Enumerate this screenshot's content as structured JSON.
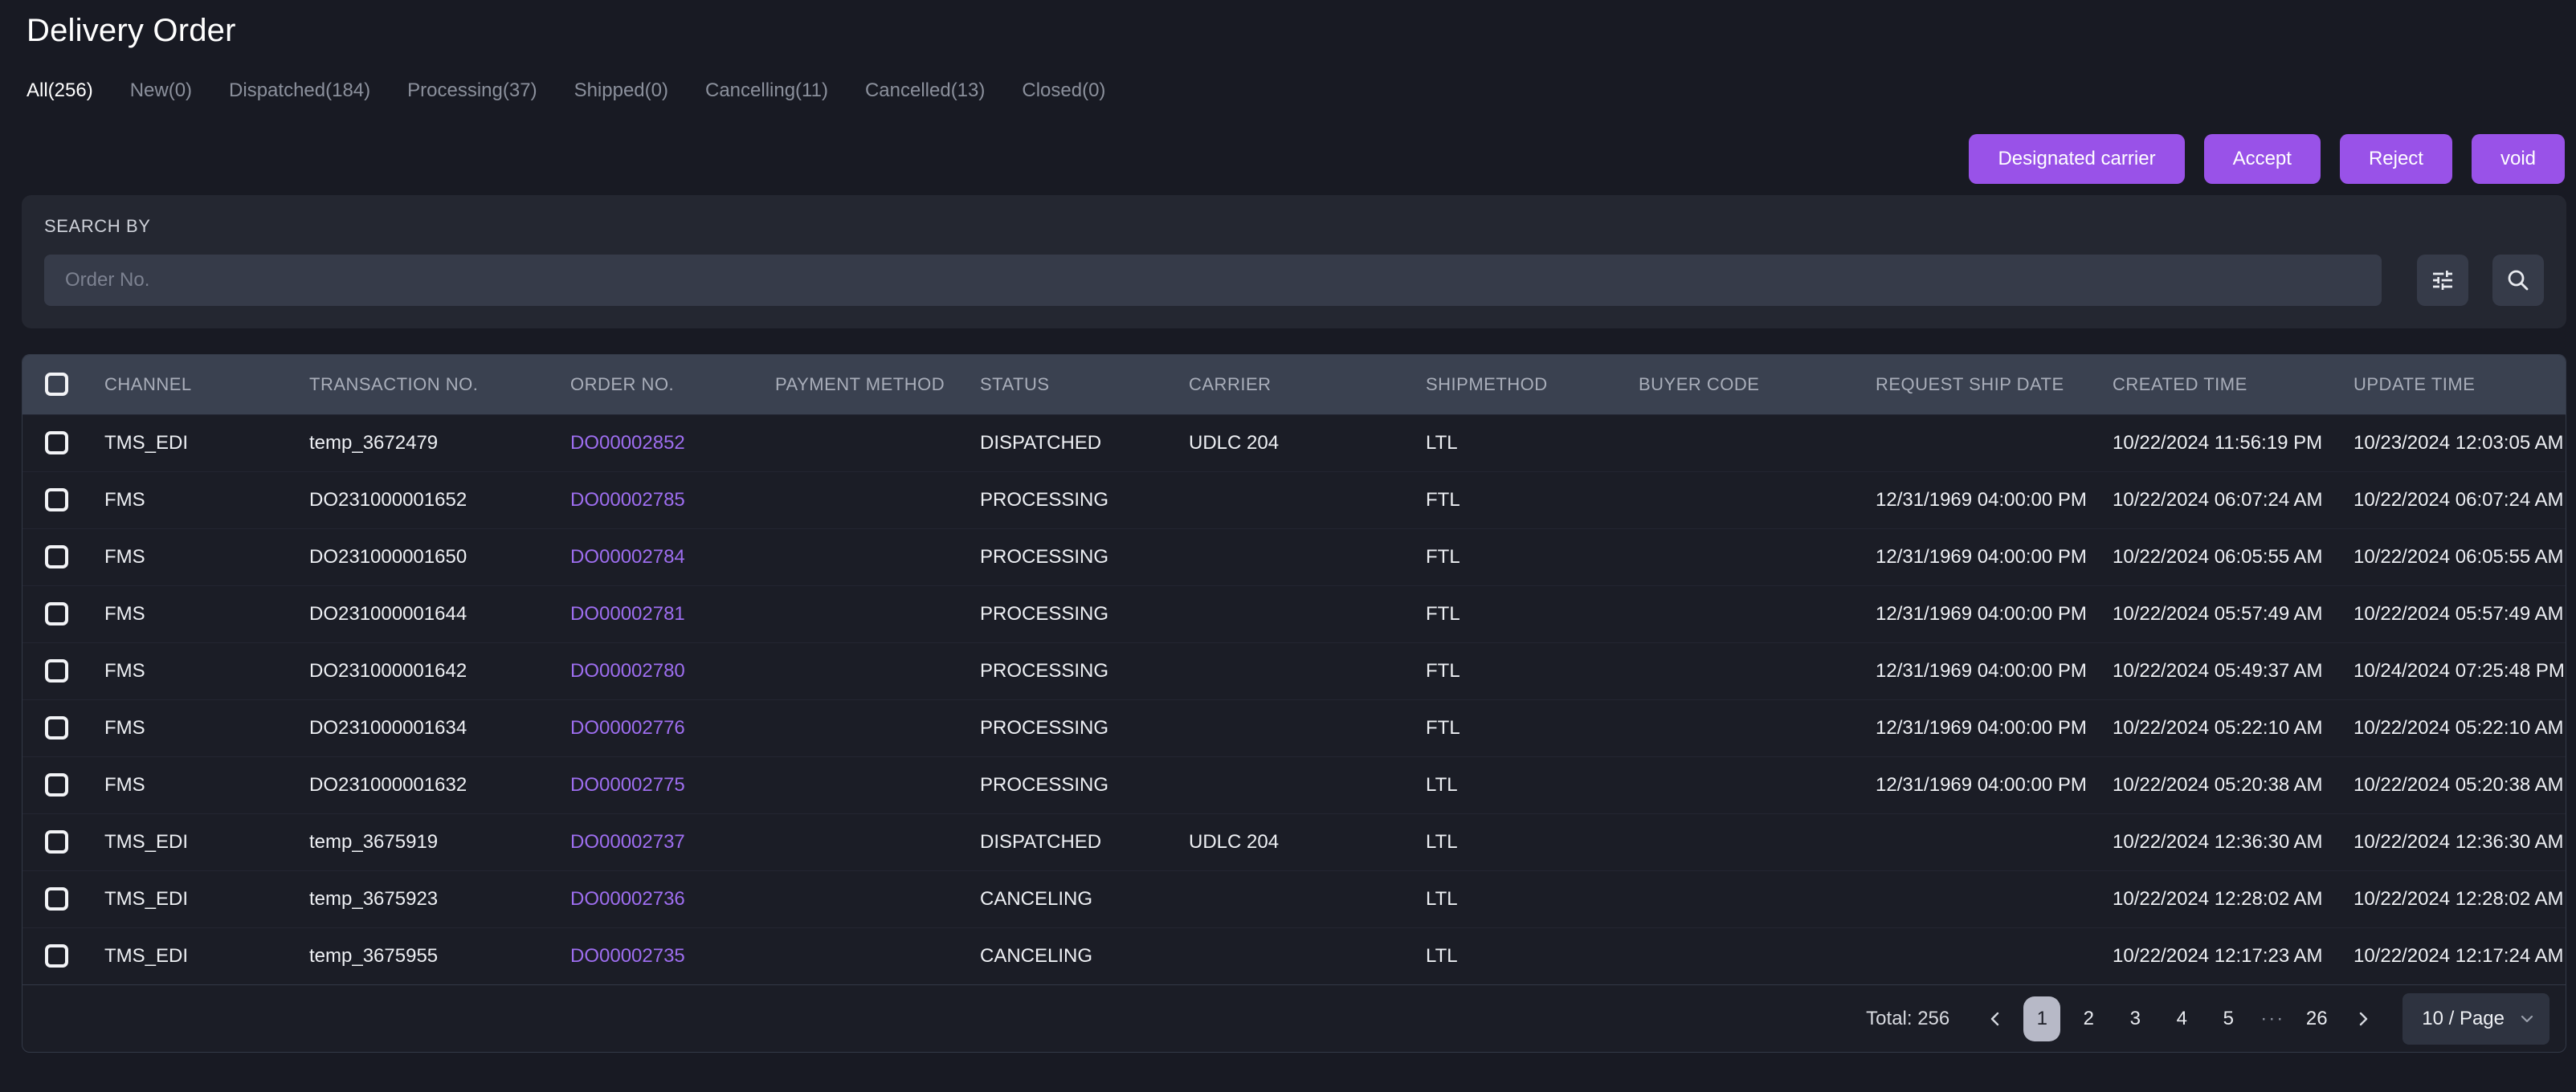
{
  "page": {
    "title": "Delivery Order"
  },
  "tabs": [
    {
      "key": "all",
      "label": "All(256)",
      "active": true
    },
    {
      "key": "new",
      "label": "New(0)",
      "active": false
    },
    {
      "key": "dispatched",
      "label": "Dispatched(184)",
      "active": false
    },
    {
      "key": "processing",
      "label": "Processing(37)",
      "active": false
    },
    {
      "key": "shipped",
      "label": "Shipped(0)",
      "active": false
    },
    {
      "key": "cancelling",
      "label": "Cancelling(11)",
      "active": false
    },
    {
      "key": "cancelled",
      "label": "Cancelled(13)",
      "active": false
    },
    {
      "key": "closed",
      "label": "Closed(0)",
      "active": false
    }
  ],
  "actions": {
    "designated_carrier": "Designated carrier",
    "accept": "Accept",
    "reject": "Reject",
    "void": "void"
  },
  "search": {
    "label": "SEARCH BY",
    "placeholder": "Order No."
  },
  "icons": {
    "filter": "tune-sliders-icon",
    "search": "magnifier-icon"
  },
  "table": {
    "columns": [
      "CHANNEL",
      "TRANSACTION NO.",
      "ORDER NO.",
      "PAYMENT METHOD",
      "STATUS",
      "CARRIER",
      "SHIPMETHOD",
      "BUYER CODE",
      "REQUEST SHIP DATE",
      "CREATED TIME",
      "UPDATE TIME"
    ],
    "rows": [
      {
        "channel": "TMS_EDI",
        "transaction_no": "temp_3672479",
        "order_no": "DO00002852",
        "payment_method": "",
        "status": "DISPATCHED",
        "carrier": "UDLC 204",
        "shipmethod": "LTL",
        "buyer_code": "",
        "request_ship_date": "",
        "created_time": "10/22/2024 11:56:19 PM",
        "update_time": "10/23/2024 12:03:05 AM"
      },
      {
        "channel": "FMS",
        "transaction_no": "DO231000001652",
        "order_no": "DO00002785",
        "payment_method": "",
        "status": "PROCESSING",
        "carrier": "",
        "shipmethod": "FTL",
        "buyer_code": "",
        "request_ship_date": "12/31/1969 04:00:00 PM",
        "created_time": "10/22/2024 06:07:24 AM",
        "update_time": "10/22/2024 06:07:24 AM"
      },
      {
        "channel": "FMS",
        "transaction_no": "DO231000001650",
        "order_no": "DO00002784",
        "payment_method": "",
        "status": "PROCESSING",
        "carrier": "",
        "shipmethod": "FTL",
        "buyer_code": "",
        "request_ship_date": "12/31/1969 04:00:00 PM",
        "created_time": "10/22/2024 06:05:55 AM",
        "update_time": "10/22/2024 06:05:55 AM"
      },
      {
        "channel": "FMS",
        "transaction_no": "DO231000001644",
        "order_no": "DO00002781",
        "payment_method": "",
        "status": "PROCESSING",
        "carrier": "",
        "shipmethod": "FTL",
        "buyer_code": "",
        "request_ship_date": "12/31/1969 04:00:00 PM",
        "created_time": "10/22/2024 05:57:49 AM",
        "update_time": "10/22/2024 05:57:49 AM"
      },
      {
        "channel": "FMS",
        "transaction_no": "DO231000001642",
        "order_no": "DO00002780",
        "payment_method": "",
        "status": "PROCESSING",
        "carrier": "",
        "shipmethod": "FTL",
        "buyer_code": "",
        "request_ship_date": "12/31/1969 04:00:00 PM",
        "created_time": "10/22/2024 05:49:37 AM",
        "update_time": "10/24/2024 07:25:48 PM"
      },
      {
        "channel": "FMS",
        "transaction_no": "DO231000001634",
        "order_no": "DO00002776",
        "payment_method": "",
        "status": "PROCESSING",
        "carrier": "",
        "shipmethod": "FTL",
        "buyer_code": "",
        "request_ship_date": "12/31/1969 04:00:00 PM",
        "created_time": "10/22/2024 05:22:10 AM",
        "update_time": "10/22/2024 05:22:10 AM"
      },
      {
        "channel": "FMS",
        "transaction_no": "DO231000001632",
        "order_no": "DO00002775",
        "payment_method": "",
        "status": "PROCESSING",
        "carrier": "",
        "shipmethod": "LTL",
        "buyer_code": "",
        "request_ship_date": "12/31/1969 04:00:00 PM",
        "created_time": "10/22/2024 05:20:38 AM",
        "update_time": "10/22/2024 05:20:38 AM"
      },
      {
        "channel": "TMS_EDI",
        "transaction_no": "temp_3675919",
        "order_no": "DO00002737",
        "payment_method": "",
        "status": "DISPATCHED",
        "carrier": "UDLC 204",
        "shipmethod": "LTL",
        "buyer_code": "",
        "request_ship_date": "",
        "created_time": "10/22/2024 12:36:30 AM",
        "update_time": "10/22/2024 12:36:30 AM"
      },
      {
        "channel": "TMS_EDI",
        "transaction_no": "temp_3675923",
        "order_no": "DO00002736",
        "payment_method": "",
        "status": "CANCELING",
        "carrier": "",
        "shipmethod": "LTL",
        "buyer_code": "",
        "request_ship_date": "",
        "created_time": "10/22/2024 12:28:02 AM",
        "update_time": "10/22/2024 12:28:02 AM"
      },
      {
        "channel": "TMS_EDI",
        "transaction_no": "temp_3675955",
        "order_no": "DO00002735",
        "payment_method": "",
        "status": "CANCELING",
        "carrier": "",
        "shipmethod": "LTL",
        "buyer_code": "",
        "request_ship_date": "",
        "created_time": "10/22/2024 12:17:23 AM",
        "update_time": "10/22/2024 12:17:24 AM"
      }
    ]
  },
  "pagination": {
    "total_label": "Total: 256",
    "pages": [
      "1",
      "2",
      "3",
      "4",
      "5",
      "···",
      "26"
    ],
    "active_page": "1",
    "page_size": "10 / Page"
  },
  "colors": {
    "accent_purple": "#9952e8",
    "link_purple": "#9e6ef0",
    "page_background": "#181a23",
    "table_header_background": "#3a4150",
    "active_page_pill": "#b7b9c7"
  }
}
